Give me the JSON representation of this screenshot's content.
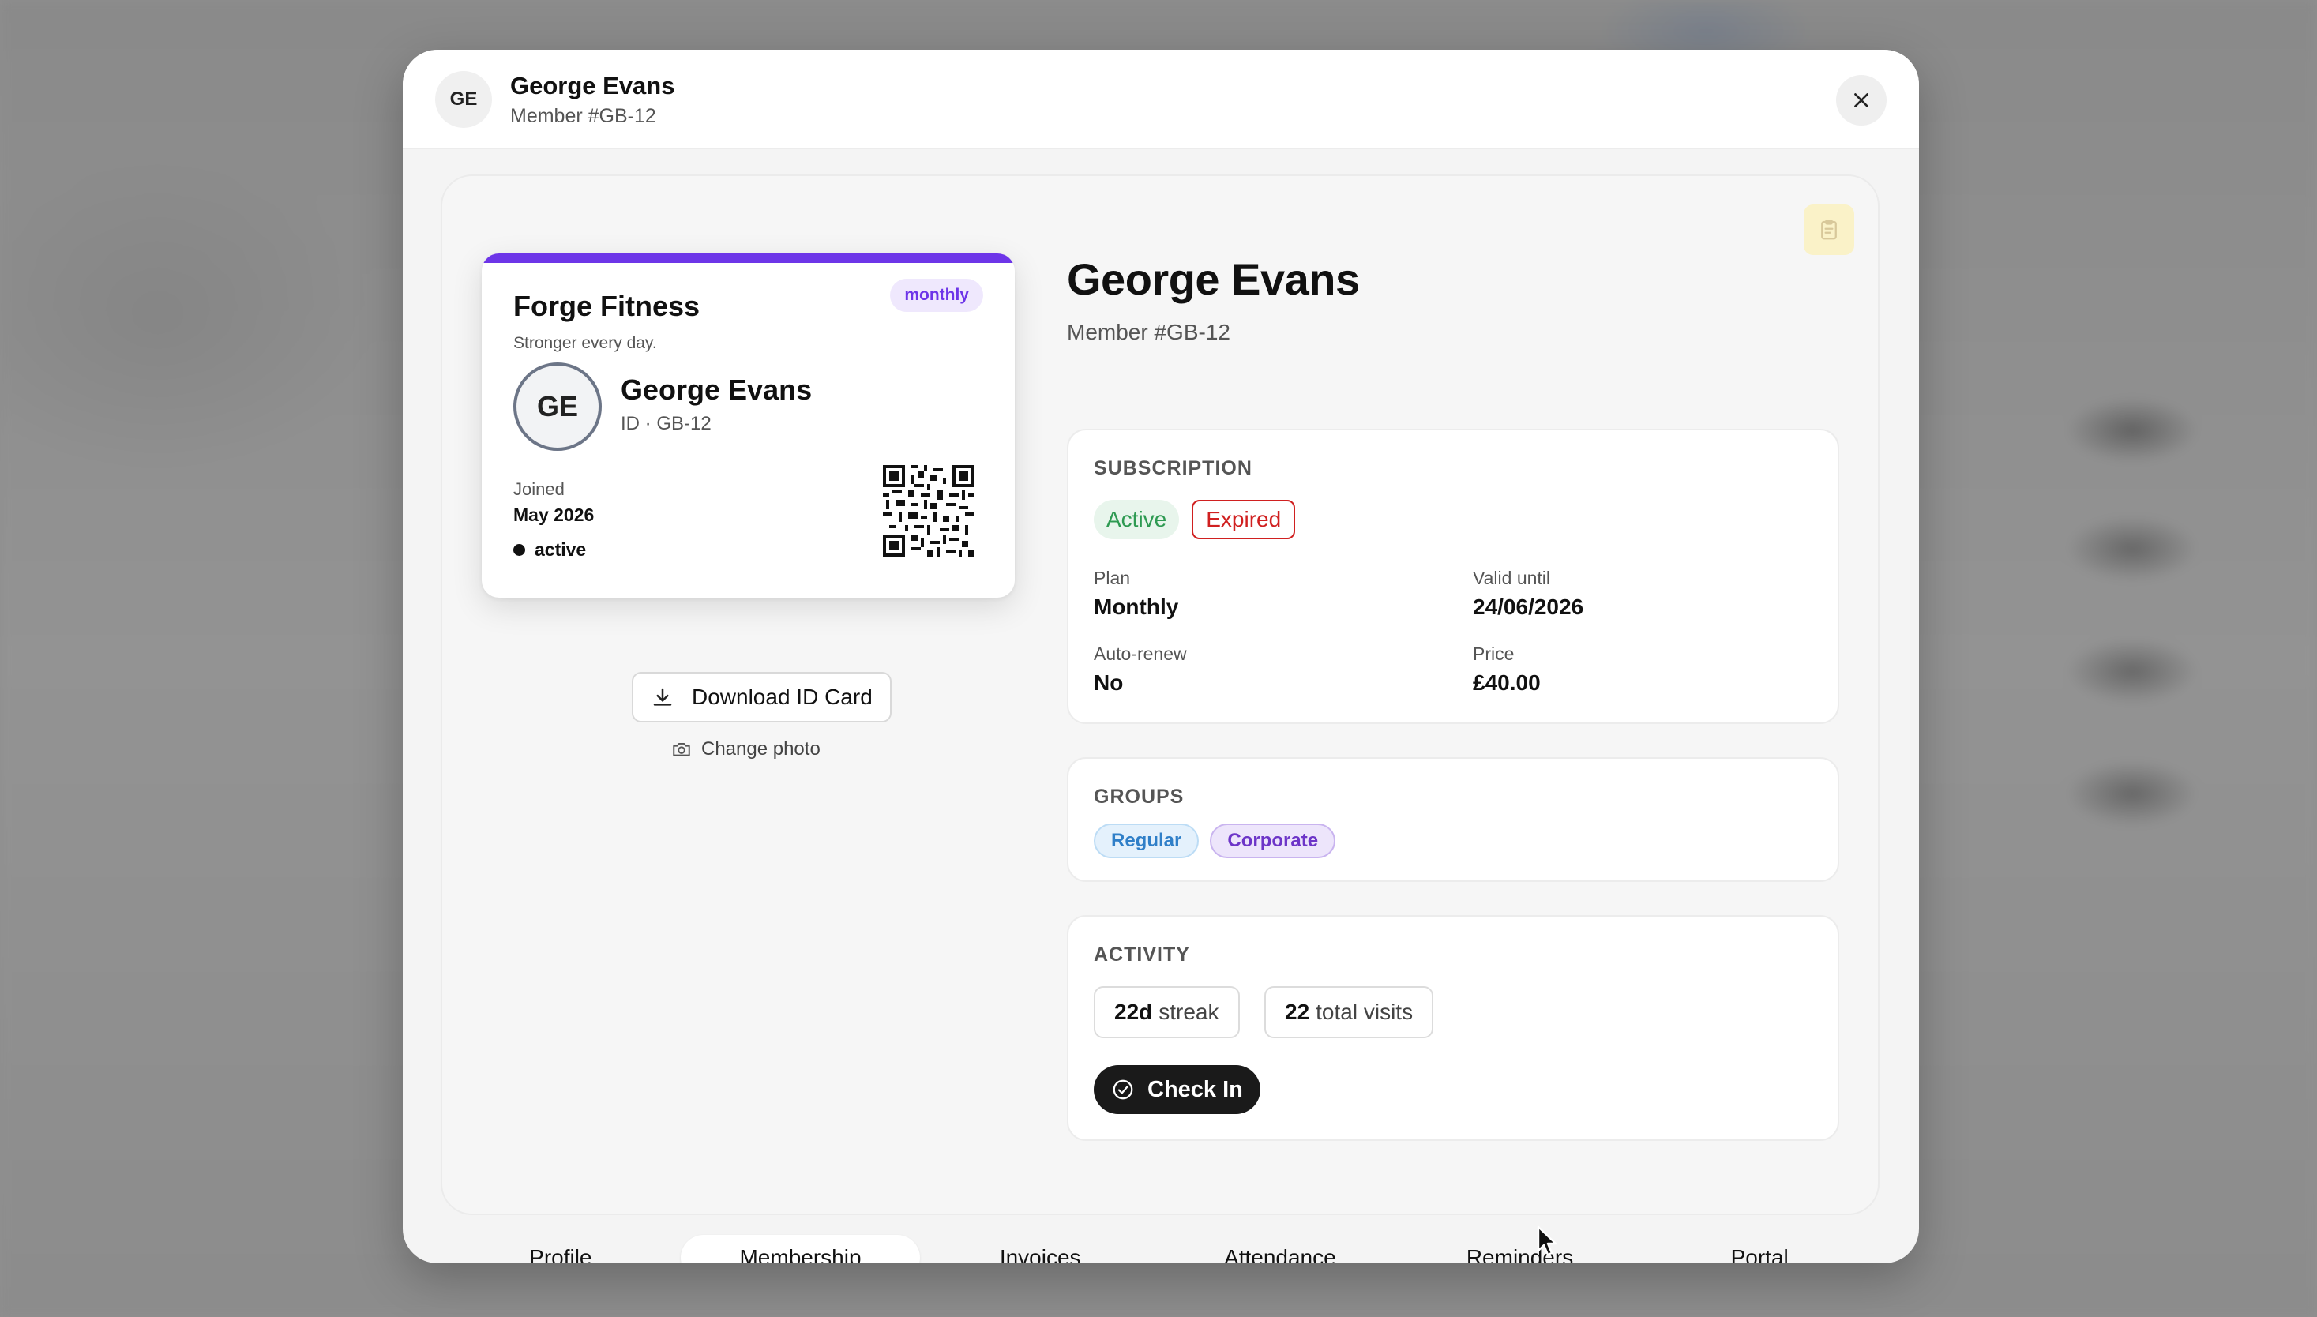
{
  "header": {
    "avatar_initials": "GE",
    "name": "George Evans",
    "member_no": "Member #GB-12"
  },
  "id_card": {
    "gym_name": "Forge Fitness",
    "tagline": "Stronger every day.",
    "plan_badge": "monthly",
    "avatar_initials": "GE",
    "name": "George Evans",
    "id_text": "ID · GB-12",
    "joined_label": "Joined",
    "joined_value": "May 2026",
    "status": "active",
    "accent_color": "#6d35e8"
  },
  "actions": {
    "download_label": "Download ID Card",
    "change_photo_label": "Change photo"
  },
  "member": {
    "name": "George Evans",
    "member_no": "Member #GB-12"
  },
  "subscription": {
    "title": "SUBSCRIPTION",
    "badge_active": "Active",
    "badge_expired": "Expired",
    "plan_label": "Plan",
    "plan_value": "Monthly",
    "valid_label": "Valid until",
    "valid_value": "24/06/2026",
    "autorenew_label": "Auto-renew",
    "autorenew_value": "No",
    "price_label": "Price",
    "price_value": "£40.00"
  },
  "groups": {
    "title": "GROUPS",
    "items": [
      "Regular",
      "Corporate"
    ]
  },
  "activity": {
    "title": "ACTIVITY",
    "streak_value": "22d",
    "streak_label": "streak",
    "visits_value": "22",
    "visits_label": "total visits",
    "checkin_label": "Check In"
  },
  "tabs": [
    {
      "label": "Profile",
      "active": false
    },
    {
      "label": "Membership",
      "active": true
    },
    {
      "label": "Invoices",
      "active": false
    },
    {
      "label": "Attendance",
      "active": false
    },
    {
      "label": "Reminders",
      "active": false
    },
    {
      "label": "Portal",
      "active": false
    }
  ],
  "icons": {
    "close": "close-icon",
    "note": "clipboard-icon",
    "download": "download-icon",
    "camera": "camera-icon",
    "check": "check-circle-icon"
  }
}
